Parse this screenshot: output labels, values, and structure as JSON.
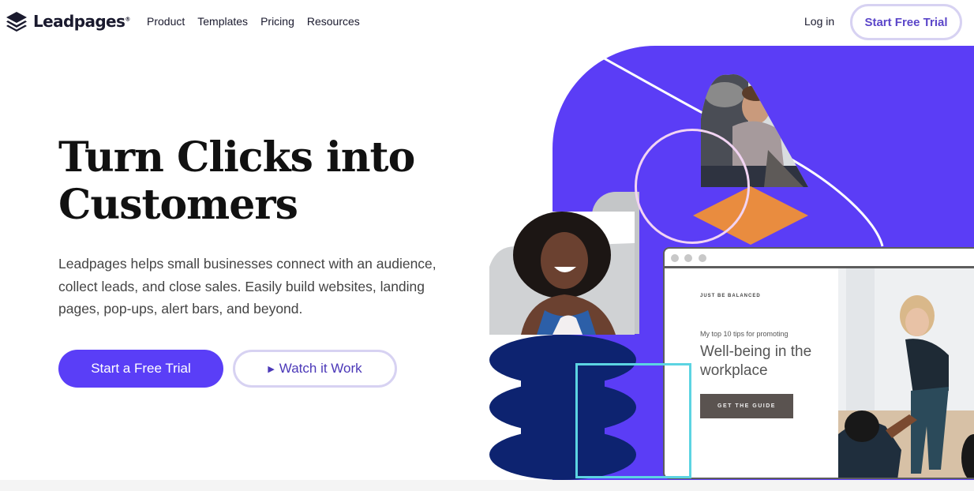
{
  "header": {
    "brand": "Leadpages",
    "brand_mark": "®",
    "nav": [
      {
        "label": "Product"
      },
      {
        "label": "Templates"
      },
      {
        "label": "Pricing"
      },
      {
        "label": "Resources"
      }
    ],
    "login_label": "Log in",
    "cta_label": "Start Free Trial"
  },
  "hero": {
    "title": "Turn Clicks into Customers",
    "description": "Leadpages helps small businesses connect with an audience, collect leads, and close sales. Easily build websites, landing pages, pop-ups, alert bars, and beyond.",
    "primary_cta": "Start a Free Trial",
    "secondary_cta": "Watch it Work",
    "secondary_icon": "play-icon"
  },
  "mockup": {
    "eyebrow": "JUST BE BALANCED",
    "kicker": "My top 10 tips for promoting",
    "title": "Well-being in the workplace",
    "button": "GET THE GUIDE"
  },
  "colors": {
    "brand_purple": "#5b3df6",
    "navy": "#0d2370",
    "orange": "#e98c3f",
    "cyan": "#5cd4e2",
    "pink": "#f2d4f3"
  }
}
